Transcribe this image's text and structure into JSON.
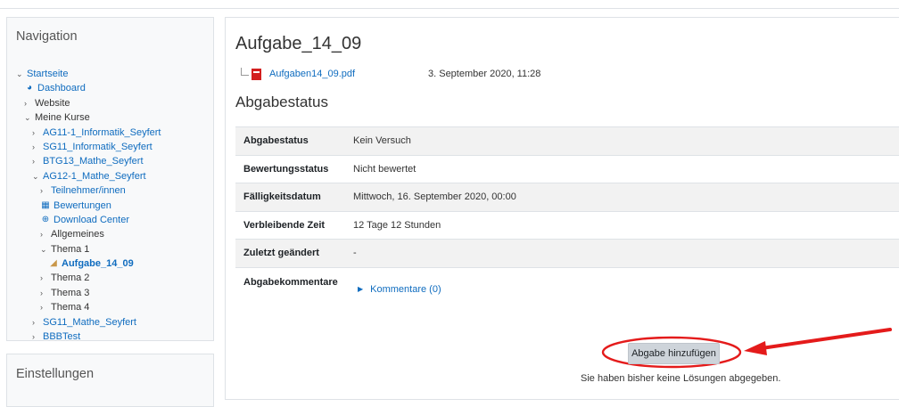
{
  "navigation": {
    "title": "Navigation",
    "items": [
      {
        "label": "Startseite",
        "state": "open",
        "style": "link",
        "indent": 0,
        "icon": ""
      },
      {
        "label": "Dashboard",
        "state": "leaf",
        "style": "link",
        "indent": 1,
        "icon": "dashboard-icon"
      },
      {
        "label": "Website",
        "state": "closed",
        "style": "plain",
        "indent": 1,
        "icon": ""
      },
      {
        "label": "Meine Kurse",
        "state": "open",
        "style": "plain",
        "indent": 1,
        "icon": ""
      },
      {
        "label": "AG11-1_Informatik_Seyfert",
        "state": "closed",
        "style": "link",
        "indent": 2,
        "icon": ""
      },
      {
        "label": "SG11_Informatik_Seyfert",
        "state": "closed",
        "style": "link",
        "indent": 2,
        "icon": ""
      },
      {
        "label": "BTG13_Mathe_Seyfert",
        "state": "closed",
        "style": "link",
        "indent": 2,
        "icon": ""
      },
      {
        "label": "AG12-1_Mathe_Seyfert",
        "state": "open",
        "style": "link",
        "indent": 2,
        "icon": ""
      },
      {
        "label": "Teilnehmer/innen",
        "state": "closed",
        "style": "link",
        "indent": 3,
        "icon": ""
      },
      {
        "label": "Bewertungen",
        "state": "leaf",
        "style": "link",
        "indent": 3,
        "icon": "table-icon"
      },
      {
        "label": "Download Center",
        "state": "leaf",
        "style": "link",
        "indent": 3,
        "icon": "download-icon"
      },
      {
        "label": "Allgemeines",
        "state": "closed",
        "style": "plain",
        "indent": 3,
        "icon": ""
      },
      {
        "label": "Thema 1",
        "state": "open",
        "style": "plain",
        "indent": 3,
        "icon": ""
      },
      {
        "label": "Aufgabe_14_09",
        "state": "leaf",
        "style": "current",
        "indent": 4,
        "icon": "assignment-icon"
      },
      {
        "label": "Thema 2",
        "state": "closed",
        "style": "plain",
        "indent": 3,
        "icon": ""
      },
      {
        "label": "Thema 3",
        "state": "closed",
        "style": "plain",
        "indent": 3,
        "icon": ""
      },
      {
        "label": "Thema 4",
        "state": "closed",
        "style": "plain",
        "indent": 3,
        "icon": ""
      },
      {
        "label": "SG11_Mathe_Seyfert",
        "state": "closed",
        "style": "link",
        "indent": 2,
        "icon": ""
      },
      {
        "label": "BBBTest",
        "state": "closed",
        "style": "link",
        "indent": 2,
        "icon": ""
      }
    ]
  },
  "settings": {
    "title": "Einstellungen"
  },
  "main": {
    "title": "Aufgabe_14_09",
    "file": {
      "name": "Aufgaben14_09.pdf",
      "date": "3. September 2020, 11:28",
      "icon": "pdf-icon"
    },
    "section_title": "Abgabestatus",
    "status_rows": [
      {
        "label": "Abgabestatus",
        "value": "Kein Versuch"
      },
      {
        "label": "Bewertungsstatus",
        "value": "Nicht bewertet"
      },
      {
        "label": "Fälligkeitsdatum",
        "value": "Mittwoch, 16. September 2020, 00:00"
      },
      {
        "label": "Verbleibende Zeit",
        "value": "12 Tage 12 Stunden"
      },
      {
        "label": "Zuletzt geändert",
        "value": "-"
      }
    ],
    "comments": {
      "label": "Abgabekommentare",
      "link": "Kommentare (0)"
    },
    "submit_button": "Abgabe hinzufügen",
    "hint": "Sie haben bisher keine Lösungen abgegeben."
  },
  "annotation": {
    "color": "#e41b1b"
  }
}
